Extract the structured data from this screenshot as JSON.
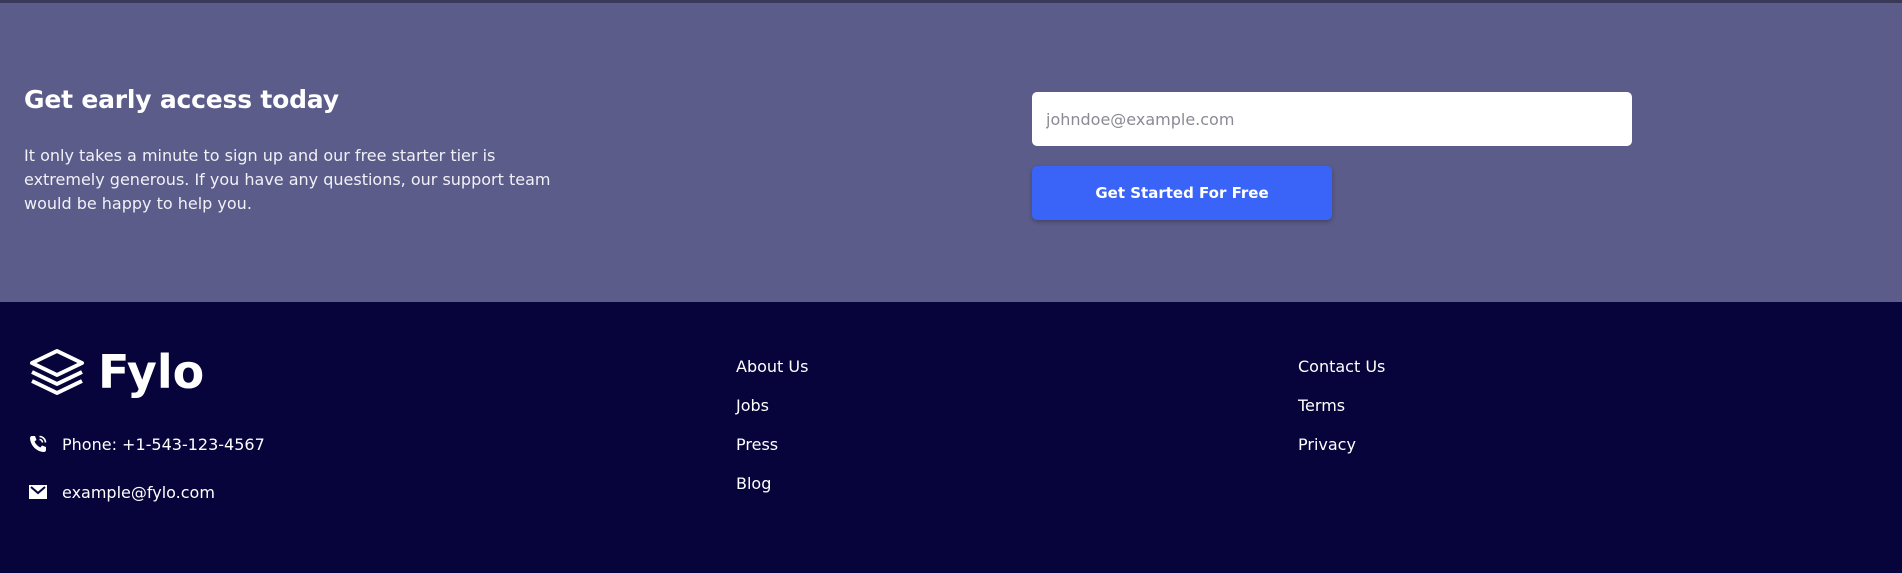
{
  "cta": {
    "title": "Get early access today",
    "description": "It only takes a minute to sign up and our free starter tier is extremely generous. If you have any questions, our support team would be happy to help you.",
    "email_placeholder": "johndoe@example.com",
    "button_label": "Get Started For Free",
    "background_color": "#5b5c8a",
    "button_color": "#3a64f7"
  },
  "footer": {
    "background_color": "#06043a",
    "logo_text": "Fylo",
    "logo_icon": "stacked-layers-icon",
    "phone": {
      "icon": "phone-icon",
      "text": "Phone: +1-543-123-4567"
    },
    "email": {
      "icon": "mail-icon",
      "text": "example@fylo.com"
    },
    "links_col1": [
      "About Us",
      "Jobs",
      "Press",
      "Blog"
    ],
    "links_col2": [
      "Contact Us",
      "Terms",
      "Privacy"
    ]
  }
}
